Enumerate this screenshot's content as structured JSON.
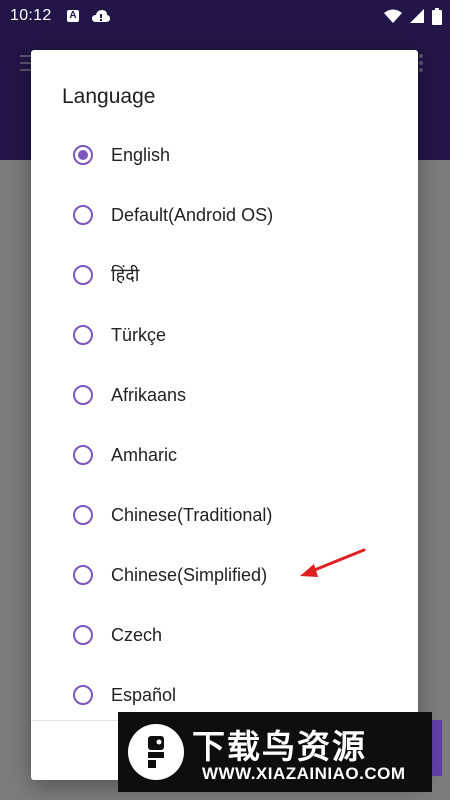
{
  "status_bar": {
    "time": "10:12",
    "notif_letter": "A",
    "icons": [
      "a-notification-icon",
      "cloud-notification-icon",
      "wifi-icon",
      "signal-icon",
      "battery-icon"
    ]
  },
  "dialog": {
    "title": "Language",
    "options": [
      {
        "label": "English",
        "selected": true
      },
      {
        "label": "Default(Android OS)",
        "selected": false
      },
      {
        "label": "हिंदी",
        "selected": false
      },
      {
        "label": "Türkçe",
        "selected": false
      },
      {
        "label": "Afrikaans",
        "selected": false
      },
      {
        "label": "Amharic",
        "selected": false
      },
      {
        "label": "Chinese(Traditional)",
        "selected": false
      },
      {
        "label": "Chinese(Simplified)",
        "selected": false
      },
      {
        "label": "Czech",
        "selected": false
      },
      {
        "label": "Español",
        "selected": false
      }
    ]
  },
  "watermark": {
    "title": "下载鸟资源",
    "url": "WWW.XIAZAINIAO.COM"
  },
  "colors": {
    "header": "#231547",
    "radio_accent": "#7b56bf",
    "arrow": "#e02020"
  }
}
